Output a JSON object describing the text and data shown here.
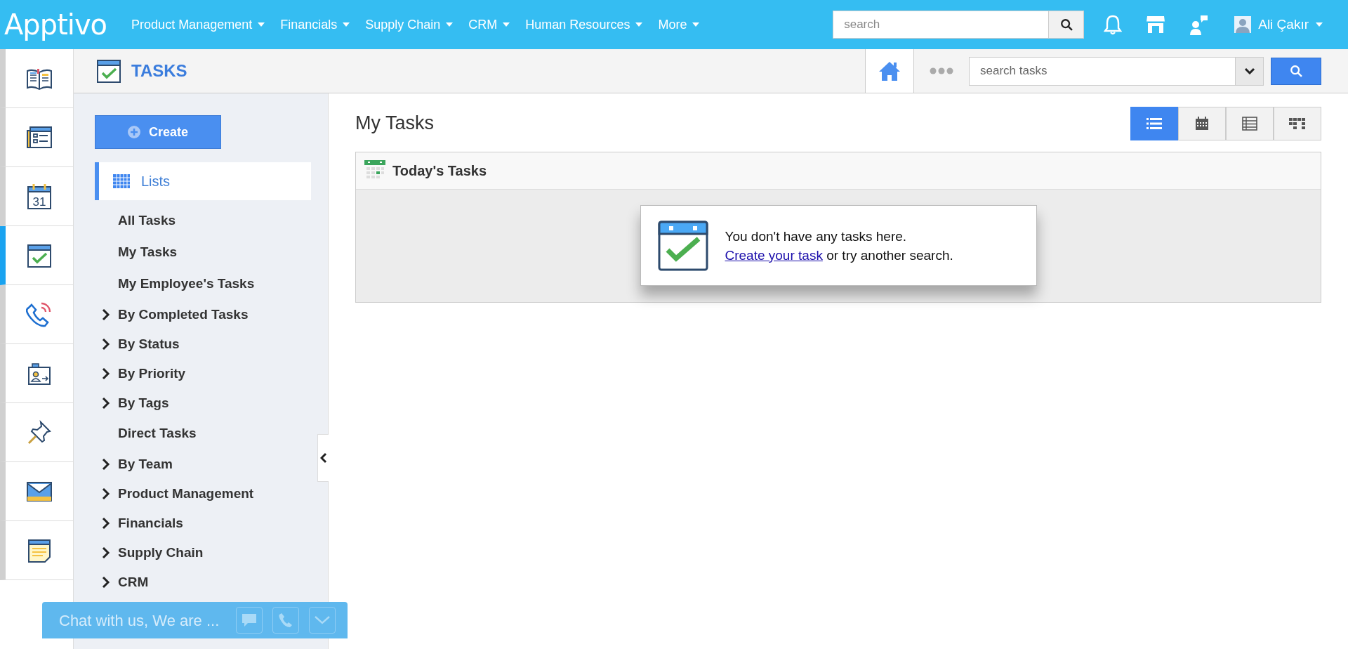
{
  "topbar": {
    "logo": "Apptivo",
    "menu": [
      {
        "label": "Product Management"
      },
      {
        "label": "Financials"
      },
      {
        "label": "Supply Chain"
      },
      {
        "label": "CRM"
      },
      {
        "label": "Human Resources"
      },
      {
        "label": "More"
      }
    ],
    "search": {
      "placeholder": "search"
    },
    "user": "Ali Çakır"
  },
  "rail": [
    {
      "kind": "book",
      "selected": false
    },
    {
      "kind": "form",
      "selected": false
    },
    {
      "kind": "calendar",
      "selected": false,
      "icon_text": "31"
    },
    {
      "kind": "task",
      "selected": true
    },
    {
      "kind": "phone",
      "selected": false
    },
    {
      "kind": "contact",
      "selected": false
    },
    {
      "kind": "pin",
      "selected": false
    },
    {
      "kind": "mail",
      "selected": false
    },
    {
      "kind": "note",
      "selected": false
    }
  ],
  "app_header": {
    "title": "TASKS",
    "search": {
      "placeholder": "search tasks"
    }
  },
  "sidebar": {
    "create_button": "Create",
    "section": {
      "label": "Lists",
      "selected": true
    },
    "items": [
      {
        "label": "All Tasks",
        "kind": "leaf"
      },
      {
        "label": "My Tasks",
        "kind": "leaf"
      },
      {
        "label": "My Employee's Tasks",
        "kind": "leaf"
      },
      {
        "label": "By Completed Tasks",
        "kind": "group",
        "expanded": false
      },
      {
        "label": "By Status",
        "kind": "group",
        "expanded": false
      },
      {
        "label": "By Priority",
        "kind": "group",
        "expanded": false
      },
      {
        "label": "By Tags",
        "kind": "group",
        "expanded": false
      },
      {
        "label": "Direct Tasks",
        "kind": "leaf"
      },
      {
        "label": "By Team",
        "kind": "group",
        "expanded": false
      },
      {
        "label": "Product Management",
        "kind": "group",
        "expanded": false
      },
      {
        "label": "Financials",
        "kind": "group",
        "expanded": false
      },
      {
        "label": "Supply Chain",
        "kind": "group",
        "expanded": false
      },
      {
        "label": "CRM",
        "kind": "group",
        "expanded": false
      }
    ]
  },
  "main": {
    "title": "My Tasks",
    "views": [
      {
        "kind": "list",
        "selected": true
      },
      {
        "kind": "calendar",
        "selected": false
      },
      {
        "kind": "table",
        "selected": false
      },
      {
        "kind": "kanban",
        "selected": false
      }
    ],
    "panel": {
      "title": "Today's Tasks",
      "empty_message": "You don't have any tasks here.",
      "link": "Create your task",
      "after_link": " or try another search."
    }
  },
  "chat_widget": {
    "label": "Chat with us, We are ..."
  }
}
